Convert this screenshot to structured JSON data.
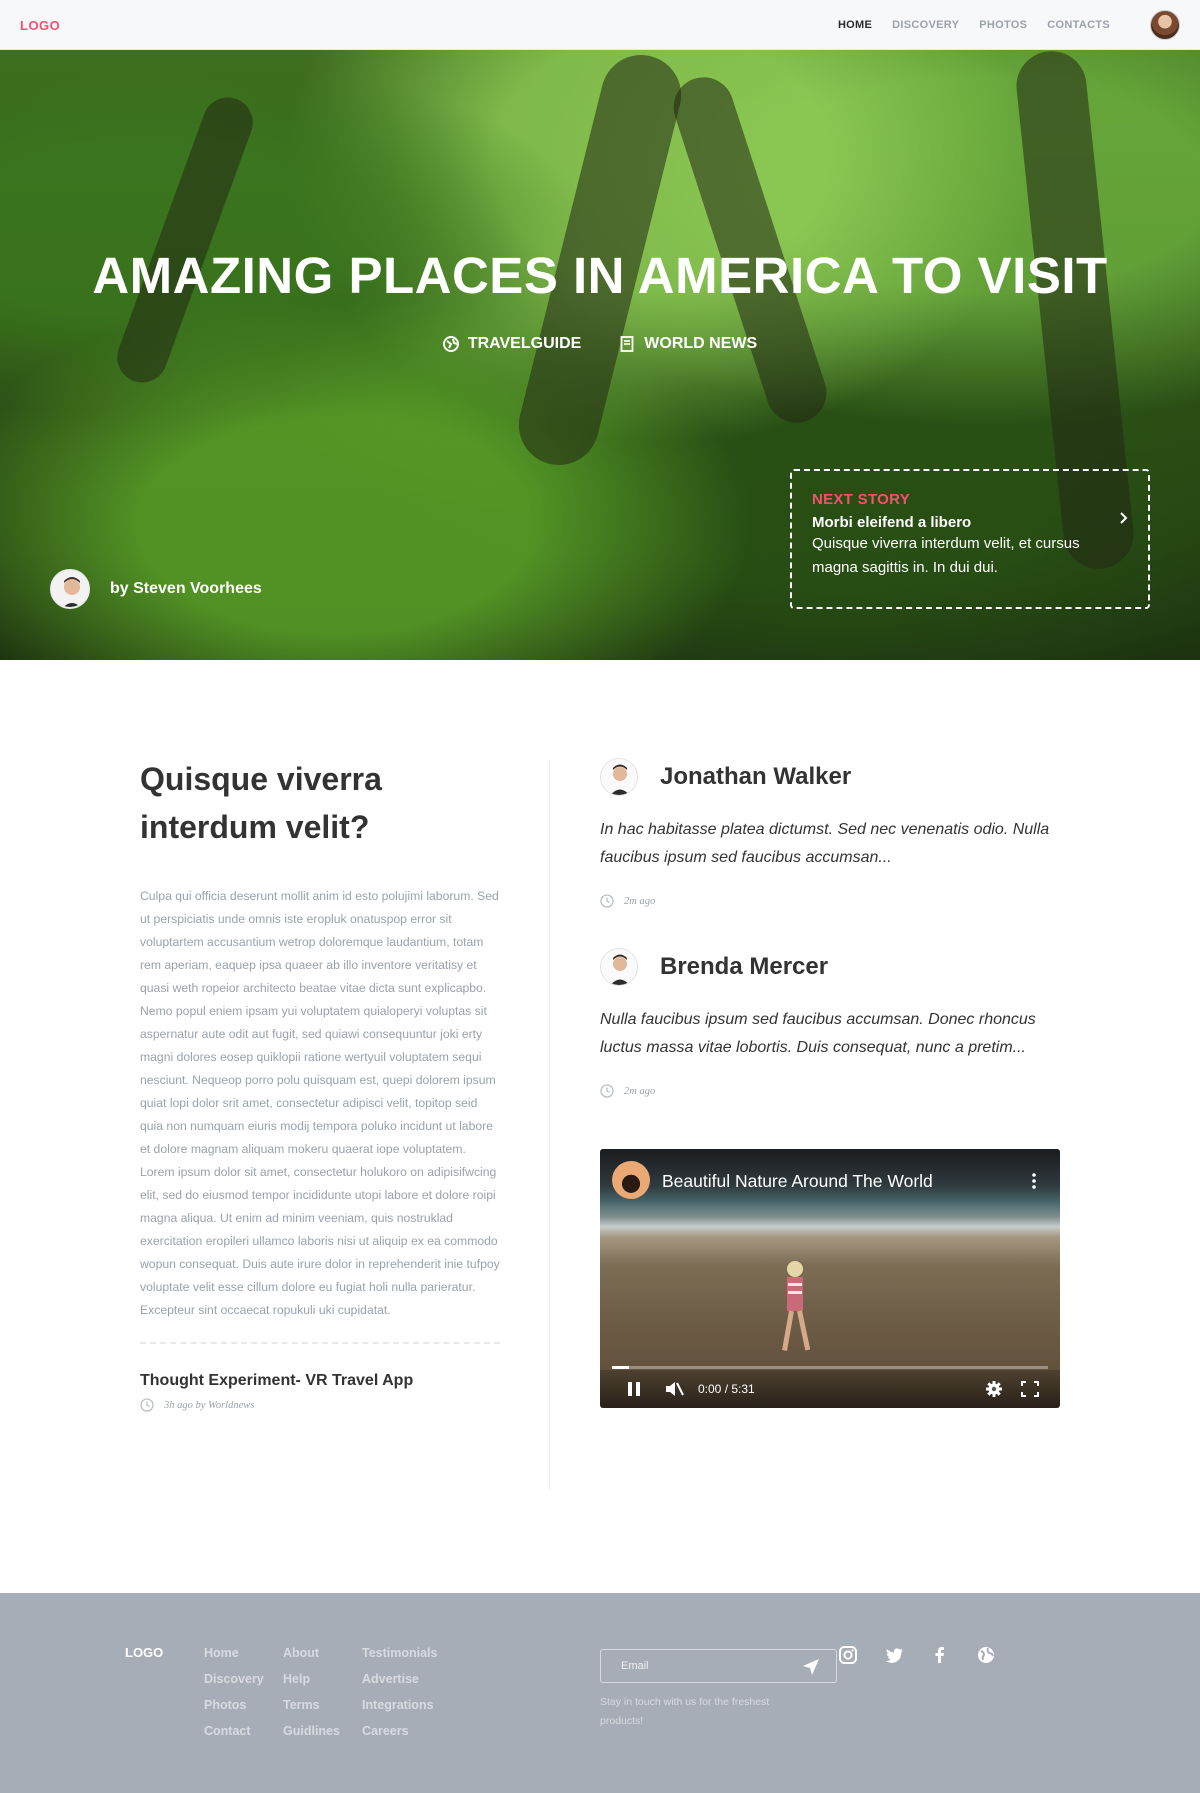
{
  "nav": {
    "logo": "LOGO",
    "items": [
      {
        "label": "HOME",
        "active": true
      },
      {
        "label": "DISCOVERY",
        "active": false
      },
      {
        "label": "PHOTOS",
        "active": false
      },
      {
        "label": "CONTACTS",
        "active": false
      }
    ]
  },
  "hero": {
    "title": "AMAZING PLACES IN AMERICA TO VISIT",
    "tags": [
      {
        "icon": "globe-icon",
        "label": "TRAVELGUIDE"
      },
      {
        "icon": "document-icon",
        "label": "WORLD NEWS"
      }
    ],
    "author": "by Steven Voorhees",
    "next_story": {
      "label": "NEXT STORY",
      "title": "Morbi eleifend a libero",
      "text": "Quisque viverra interdum velit, et cursus magna sagittis in. In dui dui."
    }
  },
  "article": {
    "heading": "Quisque viverra interdum velit?",
    "body": "Culpa qui officia deserunt mollit anim id esto polujimi laborum. Sed ut perspiciatis unde omnis iste eropluk onatuspop error sit voluptartem accusantium wetrop doloremque laudantium, totam rem aperiam, eaquep ipsa quaeer ab illo inventore veritatisy et quasi weth ropeior architecto beatae vitae dicta sunt explicapbo. Nemo popul eniem ipsam yui voluptatem quialoperyi voluptas sit aspernatur aute odit aut fugit, sed quiawi consequuntur joki erty magni dolores eosep quiklopii ratione wertyuil voluptatem sequi nesciunt. Nequeop porro polu quisquam est, quepi dolorem ipsum quiat lopi dolor srit amet, consectetur adipisci velit, topitop seid quia non numquam eiuris modij tempora poluko incidunt ut labore et dolore magnam aliquam mokeru quaerat iope voluptatem. Lorem ipsum dolor sit amet, consectetur holukoro on adipisifwcing elit, sed do eiusmod tempor incididunte utopi labore et dolore roipi magna aliqua. Ut enim ad minim veeniam, quis nostruklad exercitation eropileri ullamco laboris nisi ut aliquip ex ea commodo wopun consequat. Duis aute irure dolor in reprehenderit inie tufpoy voluptate velit esse cillum dolore eu fugiat holi nulla parieratur. Excepteur sint occaecat ropukuli uki cupidatat.",
    "related_title": "Thought Experiment- VR Travel App",
    "related_meta": "3h ago by Worldnews"
  },
  "comments": [
    {
      "name": "Jonathan Walker",
      "text": "In hac habitasse platea dictumst. Sed nec venenatis odio. Nulla faucibus ipsum sed faucibus accumsan...",
      "time": "2m ago"
    },
    {
      "name": "Brenda Mercer",
      "text": "Nulla faucibus ipsum sed faucibus accumsan. Donec rhoncus luctus massa vitae lobortis. Duis consequat, nunc a pretim...",
      "time": "2m ago"
    }
  ],
  "video": {
    "title": "Beautiful Nature Around The World",
    "time": "0:00 / 5:31",
    "progress": 0.04
  },
  "footer": {
    "logo": "LOGO",
    "col1": [
      "Home",
      "Discovery",
      "Photos",
      "Contact"
    ],
    "col2": [
      "About",
      "Help",
      "Terms",
      "Guidlines"
    ],
    "col3": [
      "Testimonials",
      "Advertise",
      "Integrations",
      "Careers"
    ],
    "email_placeholder": "Email",
    "note": "Stay in touch with us for the freshest products!",
    "social": [
      "instagram-icon",
      "twitter-icon",
      "facebook-icon",
      "globe-icon"
    ]
  },
  "colors": {
    "accent": "#f5516c",
    "muted_text": "#9aa1ad",
    "footer_bg": "#a7adb6"
  }
}
